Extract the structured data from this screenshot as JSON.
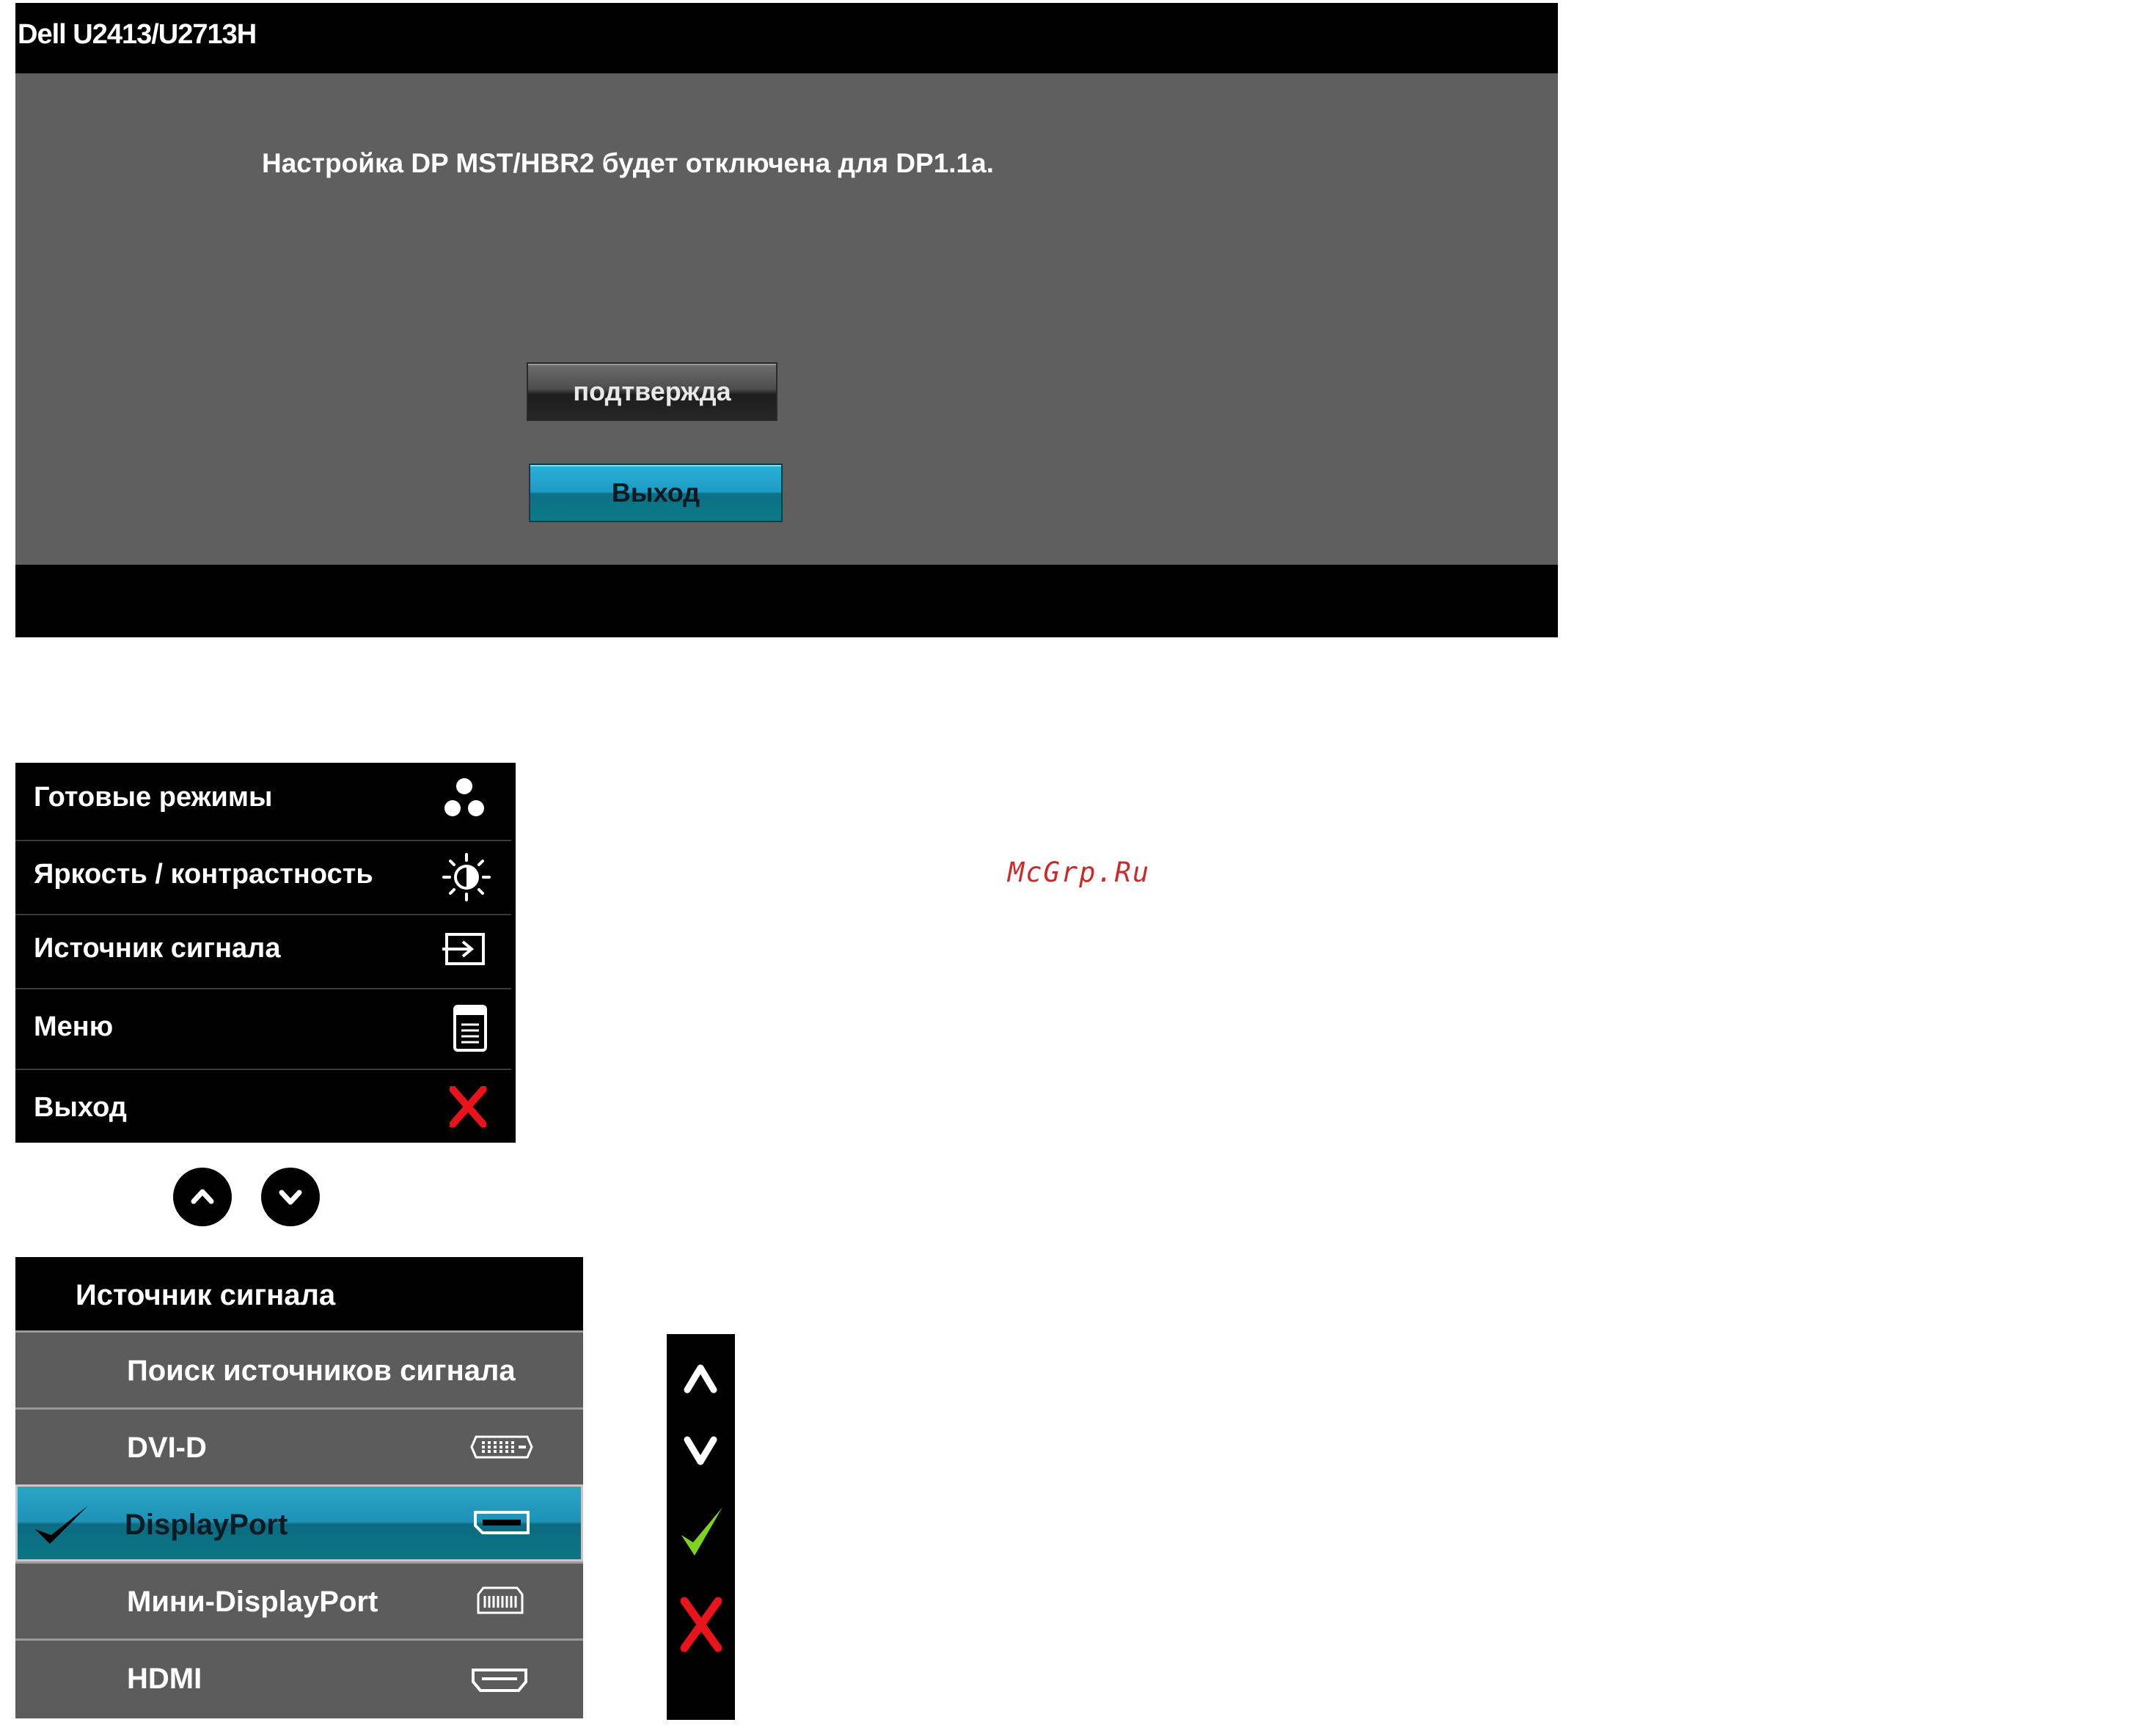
{
  "dialog": {
    "title": "Dell U2413/U2713H",
    "message": "Настройка DP MST/HBR2 будет отключена для DP1.1a.",
    "confirm_label": "подтвержда",
    "exit_label": "Выход"
  },
  "quick_menu": {
    "items": [
      {
        "label": "Готовые режимы",
        "icon": "preset-modes-icon"
      },
      {
        "label": "Яркость / контрастность",
        "icon": "brightness-contrast-icon"
      },
      {
        "label": "Источник сигнала",
        "icon": "input-source-icon"
      },
      {
        "label": "Меню",
        "icon": "menu-icon"
      },
      {
        "label": "Выход",
        "icon": "exit-x-icon"
      }
    ]
  },
  "nav": {
    "up_icon": "chevron-up-icon",
    "down_icon": "chevron-down-icon"
  },
  "source_menu": {
    "title": "Источник сигнала",
    "items": [
      {
        "label": "Поиск источников сигнала",
        "icon": ""
      },
      {
        "label": "DVI-D",
        "icon": "dvi-connector-icon"
      },
      {
        "label": "DisplayPort",
        "icon": "displayport-connector-icon",
        "selected": true
      },
      {
        "label": "Мини-DisplayPort",
        "icon": "mini-displayport-connector-icon"
      },
      {
        "label": "HDMI",
        "icon": "hdmi-connector-icon"
      }
    ]
  },
  "side_controls": [
    "up-arrow-icon",
    "down-arrow-icon",
    "confirm-check-icon",
    "exit-x-icon"
  ],
  "colors": {
    "accent": "#1d9cc6",
    "exit_red": "#e8141b",
    "check_green": "#7ed321"
  },
  "watermark": "McGrp.Ru"
}
